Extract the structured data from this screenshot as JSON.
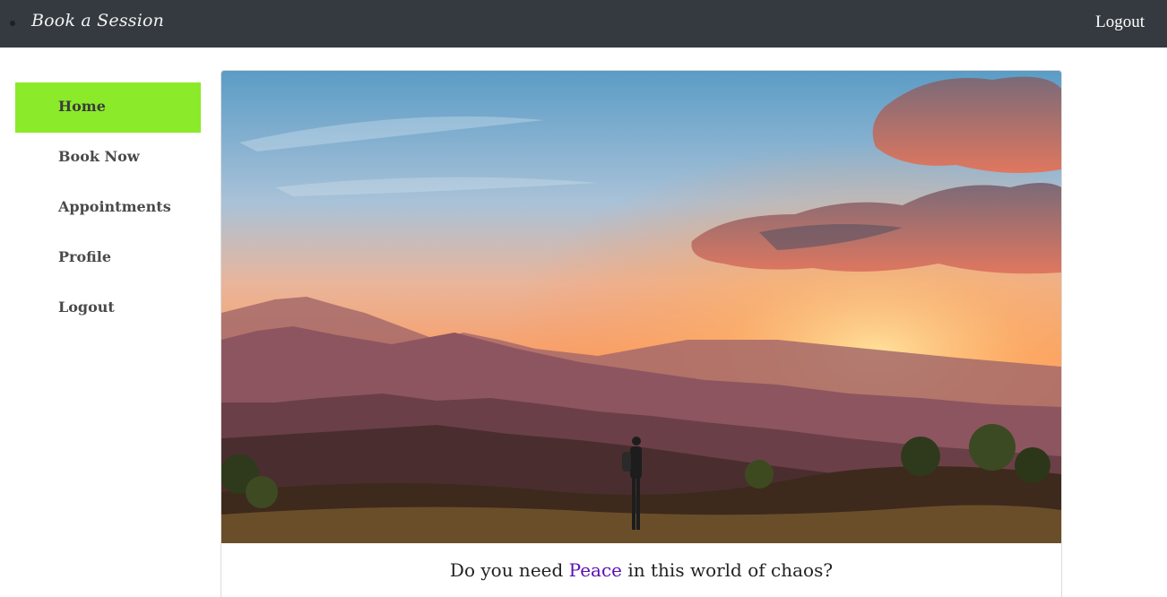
{
  "navbar": {
    "brand": "Book a Session",
    "logout_label": "Logout",
    "background": "#343a40"
  },
  "sidebar": {
    "items": [
      {
        "label": "Home",
        "active": true
      },
      {
        "label": "Book Now",
        "active": false
      },
      {
        "label": "Appointments",
        "active": false
      },
      {
        "label": "Profile",
        "active": false
      },
      {
        "label": "Logout",
        "active": false
      }
    ],
    "active_color": "#8bea2a"
  },
  "main": {
    "hero_image": "mountain-sunset-hiker",
    "caption_before": "Do you need ",
    "caption_accent": "Peace",
    "caption_after": " in this world of chaos?",
    "accent_color": "#5b0db5"
  }
}
